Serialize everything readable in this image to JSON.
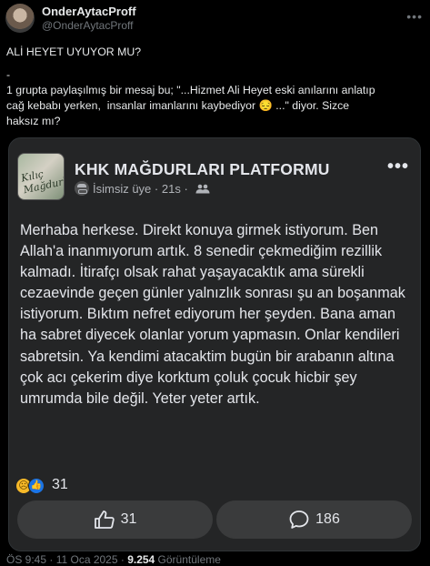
{
  "author": {
    "name": "OnderAytacProff",
    "handle": "@OnderAytacProff"
  },
  "tweet": {
    "line1": "ALİ HEYET UYUYOR MU?",
    "line2": "-",
    "line3": "1 grupta paylaşılmış bir mesaj bu; \"...Hizmet Ali Heyet eski anılarını anlatıp",
    "line4": "cağ kebabı yerken,  insanlar imanlarını kaybediyor 😔 ...\" diyor. Sizce",
    "line5": "haksız mı?"
  },
  "card": {
    "group_avatar_text": "Kılıç Mağdurları",
    "group_title": "KHK MAĞDURLARI PLATFORMU",
    "author_label": "İsimsiz üye",
    "time": "21s",
    "post_body": "Merhaba herkese. Direkt konuya girmek istiyorum. Ben Allah'a inanmıyorum artık. 8 senedir çekmediğim rezillik kalmadı. İtirafçı olsak rahat yaşayacaktık ama sürekli cezaevinde geçen günler yalnızlık sonrası şu an boşanmak istiyorum. Bıktım nefret ediyorum her şeyden. Bana aman ha sabret diyecek olanlar yorum yapmasın. Onlar kendileri sabretsin. Ya kendimi atacaktim bugün bir arabanın altına çok acı çekerim diye korktum çoluk çocuk hicbir şey umrumda bile değil. Yeter yeter artık.",
    "reaction_count": "31",
    "like_count": "31",
    "comment_count": "186"
  },
  "footer": {
    "time": "ÖS 9:45 · 11 Oca 2025 · ",
    "views": "9.254",
    "views_label": " Görüntüleme"
  },
  "colors": {
    "background": "#000000",
    "card": "#242526",
    "button": "#3a3b3c",
    "like_blue": "#1b74e4",
    "sad_yellow": "#f7b928"
  },
  "icons": [
    "more-icon",
    "anonymous-icon",
    "group-icon",
    "sad-reaction-icon",
    "like-reaction-icon",
    "thumbs-up-icon",
    "comment-icon"
  ]
}
